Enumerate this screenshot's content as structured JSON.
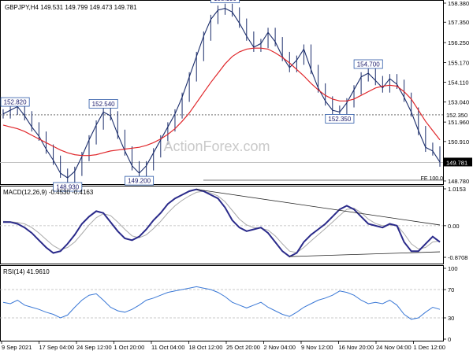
{
  "colors": {
    "price": "#1b2d6b",
    "sma": "#e0272b",
    "macd_main": "#2a2a8a",
    "macd_signal": "#a9a9a9",
    "rsi": "#3a78d6",
    "grid": "#b9b9b9",
    "label_box": "#2d5aa8",
    "watermark": "#c9c9c9"
  },
  "watermark": "ActionForex.com",
  "chart_data": [
    {
      "type": "line",
      "title": "GBPJPY,H4  149.531 149.799 149.473 149.781",
      "ylim": [
        148.78,
        158.38
      ],
      "y_ticks": [
        "158.380",
        "157.350",
        "156.250",
        "155.170",
        "154.110",
        "153.040",
        "151.960",
        "150.910",
        "149.850",
        "148.780"
      ],
      "current_price": "149.781",
      "level_label": "152.350",
      "fe_label": "FE 100.0",
      "swing_labels": [
        "152.820",
        "152.540",
        "148.930",
        "149.200",
        "158.190",
        "154.700",
        "152.350"
      ],
      "series": [
        {
          "name": "Price",
          "values": [
            152.4,
            152.6,
            152.8,
            152.3,
            151.7,
            151.2,
            150.5,
            149.9,
            149.2,
            148.95,
            149.3,
            150.1,
            151.0,
            151.8,
            152.5,
            152.3,
            151.3,
            150.4,
            149.6,
            149.2,
            149.6,
            150.3,
            151.0,
            151.7,
            152.4,
            153.3,
            154.4,
            155.5,
            156.6,
            157.5,
            158.0,
            158.1,
            157.9,
            157.3,
            156.6,
            156.0,
            156.2,
            156.8,
            156.3,
            155.5,
            154.9,
            155.3,
            155.9,
            154.8,
            153.8,
            153.1,
            152.6,
            152.5,
            153.0,
            153.7,
            154.4,
            154.6,
            154.2,
            153.8,
            154.3,
            154.0,
            153.3,
            152.5,
            151.5,
            150.6,
            150.4,
            149.8
          ]
        },
        {
          "name": "SMA",
          "values": [
            151.8,
            151.7,
            151.6,
            151.45,
            151.25,
            151.05,
            150.85,
            150.65,
            150.45,
            150.3,
            150.2,
            150.15,
            150.15,
            150.2,
            150.3,
            150.4,
            150.45,
            150.5,
            150.55,
            150.6,
            150.7,
            150.85,
            151.05,
            151.3,
            151.6,
            152.0,
            152.45,
            153.0,
            153.55,
            154.1,
            154.6,
            155.1,
            155.5,
            155.75,
            155.9,
            155.95,
            155.95,
            155.9,
            155.7,
            155.45,
            155.15,
            154.8,
            154.45,
            154.05,
            153.7,
            153.4,
            153.2,
            153.1,
            153.1,
            153.2,
            153.4,
            153.6,
            153.8,
            153.9,
            153.95,
            153.9,
            153.6,
            153.2,
            152.6,
            152.0,
            151.5,
            151.0
          ]
        }
      ]
    },
    {
      "type": "line",
      "title": "MACD(12,26,9) -0.4530 -0.4163",
      "ylim": [
        -1.0,
        1.0153
      ],
      "y_ticks": [
        "1.0153",
        "0.00",
        "-0.8708"
      ],
      "series": [
        {
          "name": "MACD",
          "values": [
            0.1,
            0.1,
            0.05,
            -0.05,
            -0.2,
            -0.4,
            -0.6,
            -0.75,
            -0.7,
            -0.5,
            -0.25,
            0.05,
            0.25,
            0.4,
            0.35,
            0.1,
            -0.15,
            -0.35,
            -0.4,
            -0.3,
            -0.1,
            0.15,
            0.35,
            0.6,
            0.75,
            0.85,
            0.95,
            1.0,
            0.95,
            0.85,
            0.75,
            0.5,
            0.15,
            -0.05,
            -0.15,
            -0.1,
            -0.05,
            -0.2,
            -0.45,
            -0.7,
            -0.85,
            -0.75,
            -0.45,
            -0.25,
            -0.1,
            0.05,
            0.25,
            0.45,
            0.55,
            0.45,
            0.25,
            0.05,
            0.0,
            -0.05,
            0.05,
            0.0,
            -0.45,
            -0.7,
            -0.7,
            -0.5,
            -0.3,
            -0.45
          ]
        },
        {
          "name": "Signal",
          "values": [
            0.12,
            0.11,
            0.09,
            0.05,
            -0.05,
            -0.2,
            -0.38,
            -0.55,
            -0.66,
            -0.6,
            -0.45,
            -0.22,
            0.02,
            0.22,
            0.33,
            0.28,
            0.1,
            -0.1,
            -0.28,
            -0.33,
            -0.25,
            -0.08,
            0.12,
            0.35,
            0.55,
            0.7,
            0.82,
            0.92,
            0.95,
            0.9,
            0.82,
            0.66,
            0.42,
            0.18,
            0.02,
            -0.05,
            -0.07,
            -0.12,
            -0.28,
            -0.5,
            -0.7,
            -0.74,
            -0.6,
            -0.42,
            -0.25,
            -0.08,
            0.1,
            0.28,
            0.45,
            0.48,
            0.36,
            0.18,
            0.06,
            0.0,
            0.02,
            0.01,
            -0.22,
            -0.5,
            -0.64,
            -0.6,
            -0.45,
            -0.42
          ]
        }
      ]
    },
    {
      "type": "line",
      "title": "RSI(14) 41.9610",
      "ylim": [
        0,
        100
      ],
      "y_ticks": [
        "100",
        "70",
        "30",
        "0"
      ],
      "series": [
        {
          "name": "RSI",
          "values": [
            52,
            50,
            55,
            48,
            45,
            42,
            38,
            35,
            30,
            34,
            45,
            55,
            62,
            64,
            55,
            45,
            40,
            38,
            42,
            48,
            55,
            58,
            62,
            66,
            68,
            70,
            72,
            74,
            72,
            70,
            66,
            60,
            52,
            48,
            44,
            48,
            52,
            45,
            40,
            35,
            32,
            38,
            45,
            50,
            55,
            58,
            62,
            68,
            66,
            62,
            55,
            50,
            52,
            50,
            55,
            48,
            35,
            28,
            30,
            38,
            45,
            42
          ]
        }
      ],
      "x_labels": [
        "9 Sep 2021",
        "17 Sep 04:00",
        "24 Sep 12:00",
        "1 Oct 20:00",
        "11 Oct 04:00",
        "18 Oct 12:00",
        "25 Oct 20:00",
        "2 Nov 04:00",
        "9 Nov 12:00",
        "16 Nov 20:00",
        "24 Nov 04:00",
        "1 Dec 12:00"
      ]
    }
  ]
}
